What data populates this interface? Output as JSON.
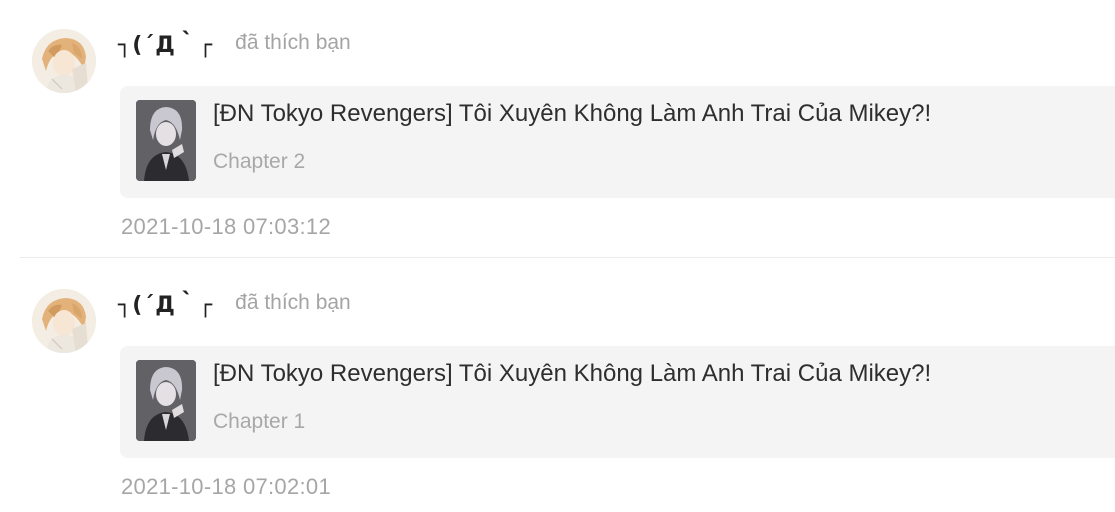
{
  "notifications": [
    {
      "username": "┐(´Д｀┌",
      "action": "đã thích bạn",
      "story_title": "[ĐN Tokyo Revengers] Tôi Xuyên Không Làm Anh Trai Của Mikey?!",
      "chapter": "Chapter 2",
      "timestamp": "2021-10-18 07:03:12"
    },
    {
      "username": "┐(´Д｀┌",
      "action": "đã thích bạn",
      "story_title": "[ĐN Tokyo Revengers] Tôi Xuyên Không Làm Anh Trai Của Mikey?!",
      "chapter": "Chapter 1",
      "timestamp": "2021-10-18 07:02:01"
    }
  ],
  "colors": {
    "card_background": "#f4f4f4",
    "muted_text": "#a6a6a6",
    "primary_text": "#2e2e2e",
    "divider": "#ececec"
  }
}
